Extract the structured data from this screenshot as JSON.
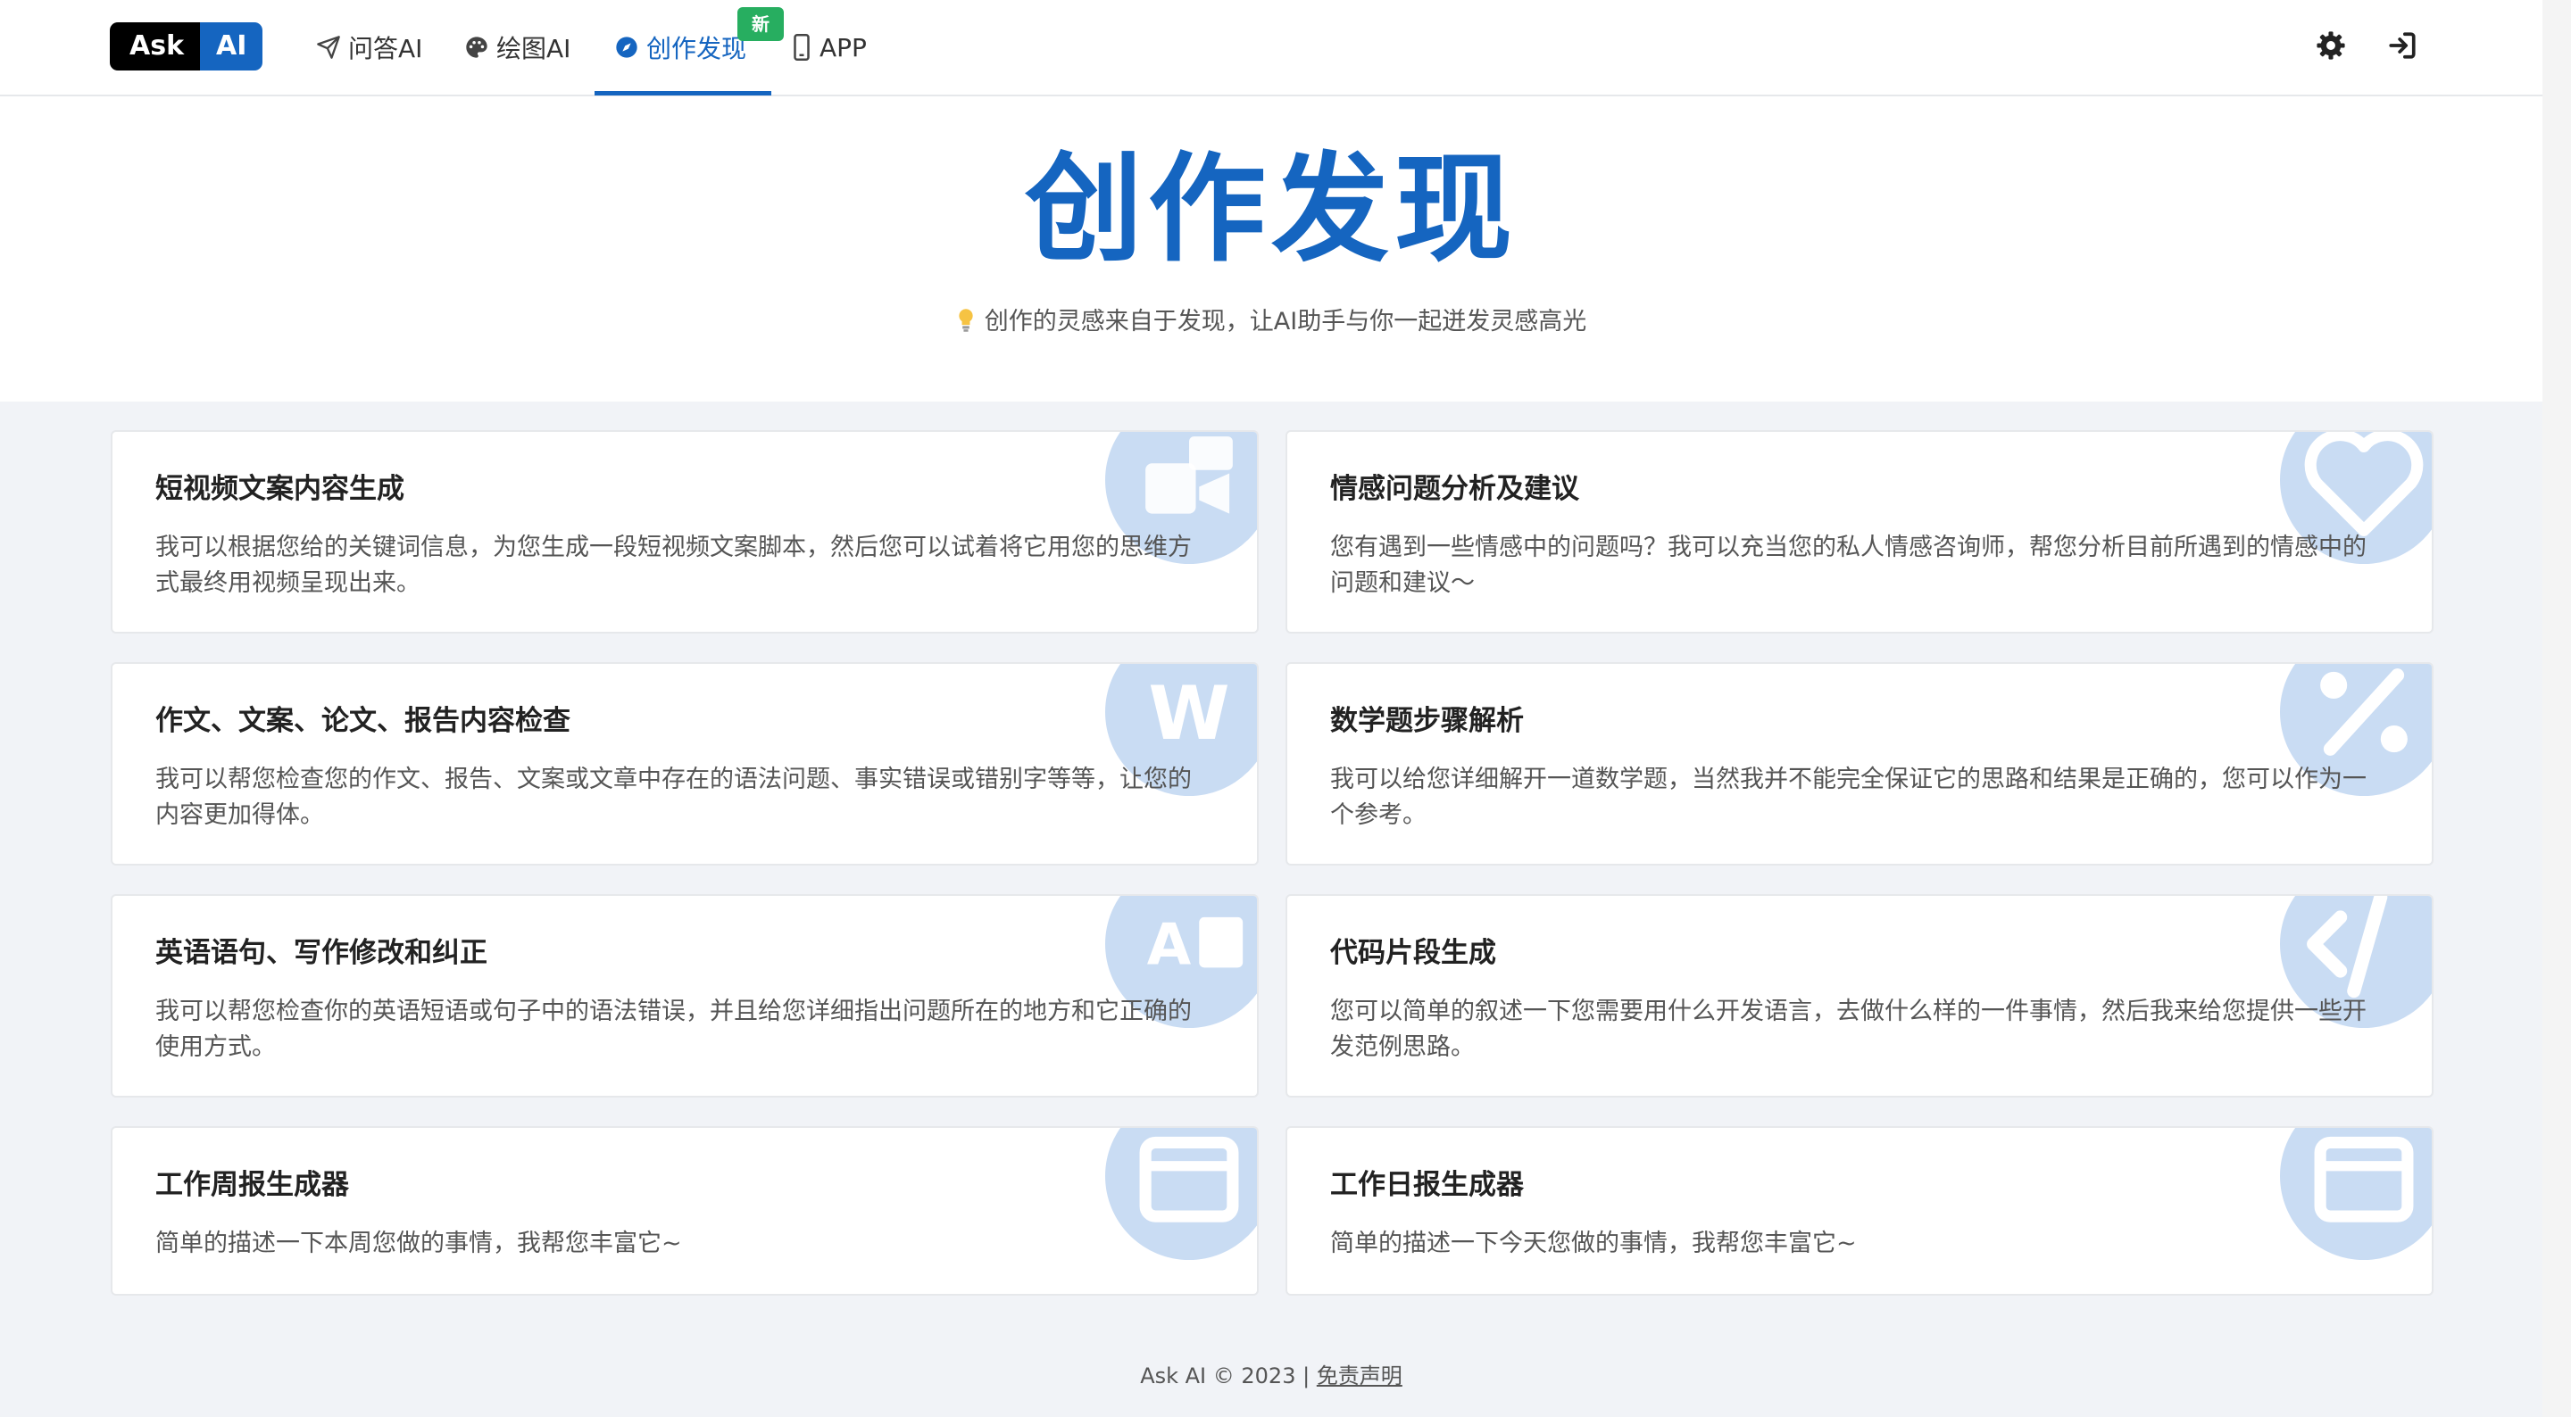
{
  "logo": {
    "part1": "Ask",
    "part2": "AI"
  },
  "nav": {
    "items": [
      {
        "label": "问答AI",
        "icon": "send-icon"
      },
      {
        "label": "绘图AI",
        "icon": "palette-icon"
      },
      {
        "label": "创作发现",
        "icon": "compass-icon",
        "active": true,
        "badge": "新"
      },
      {
        "label": "APP",
        "icon": "mobile-icon"
      }
    ],
    "right_icons": [
      "settings-gear-icon",
      "login-icon"
    ]
  },
  "hero": {
    "title": "创作发现",
    "subtitle": "创作的灵感来自于发现，让AI助手与你一起迸发灵感高光"
  },
  "cards": [
    {
      "title": "短视频文案内容生成",
      "desc": "我可以根据您给的关键词信息，为您生成一段短视频文案脚本，然后您可以试着将它用您的思维方式最终用视频呈现出来。",
      "icon": "video-script-icon"
    },
    {
      "title": "情感问题分析及建议",
      "desc": "您有遇到一些情感中的问题吗？我可以充当您的私人情感咨询师，帮您分析目前所遇到的情感中的问题和建议～",
      "icon": "heart-icon"
    },
    {
      "title": "作文、文案、论文、报告内容检查",
      "desc": "我可以帮您检查您的作文、报告、文案或文章中存在的语法问题、事实错误或错别字等等，让您的内容更加得体。",
      "icon": "word-doc-icon"
    },
    {
      "title": "数学题步骤解析",
      "desc": "我可以给您详细解开一道数学题，当然我并不能完全保证它的思路和结果是正确的，您可以作为一个参考。",
      "icon": "percent-icon"
    },
    {
      "title": "英语语句、写作修改和纠正",
      "desc": "我可以帮您检查你的英语短语或句子中的语法错误，并且给您详细指出问题所在的地方和它正确的使用方式。",
      "icon": "translate-icon"
    },
    {
      "title": "代码片段生成",
      "desc": "您可以简单的叙述一下您需要用什么开发语言，去做什么样的一件事情，然后我来给您提供一些开发范例思路。",
      "icon": "code-icon"
    },
    {
      "title": "工作周报生成器",
      "desc": "简单的描述一下本周您做的事情，我帮您丰富它~",
      "icon": "calendar-week-icon"
    },
    {
      "title": "工作日报生成器",
      "desc": "简单的描述一下今天您做的事情，我帮您丰富它~",
      "icon": "calendar-day-icon"
    }
  ],
  "footer": {
    "text": "Ask AI © 2023 | ",
    "link": "免责声明"
  },
  "colors": {
    "brand": "#1565c0",
    "badge": "#27ae60",
    "card_icon": "#c9dcf3"
  }
}
